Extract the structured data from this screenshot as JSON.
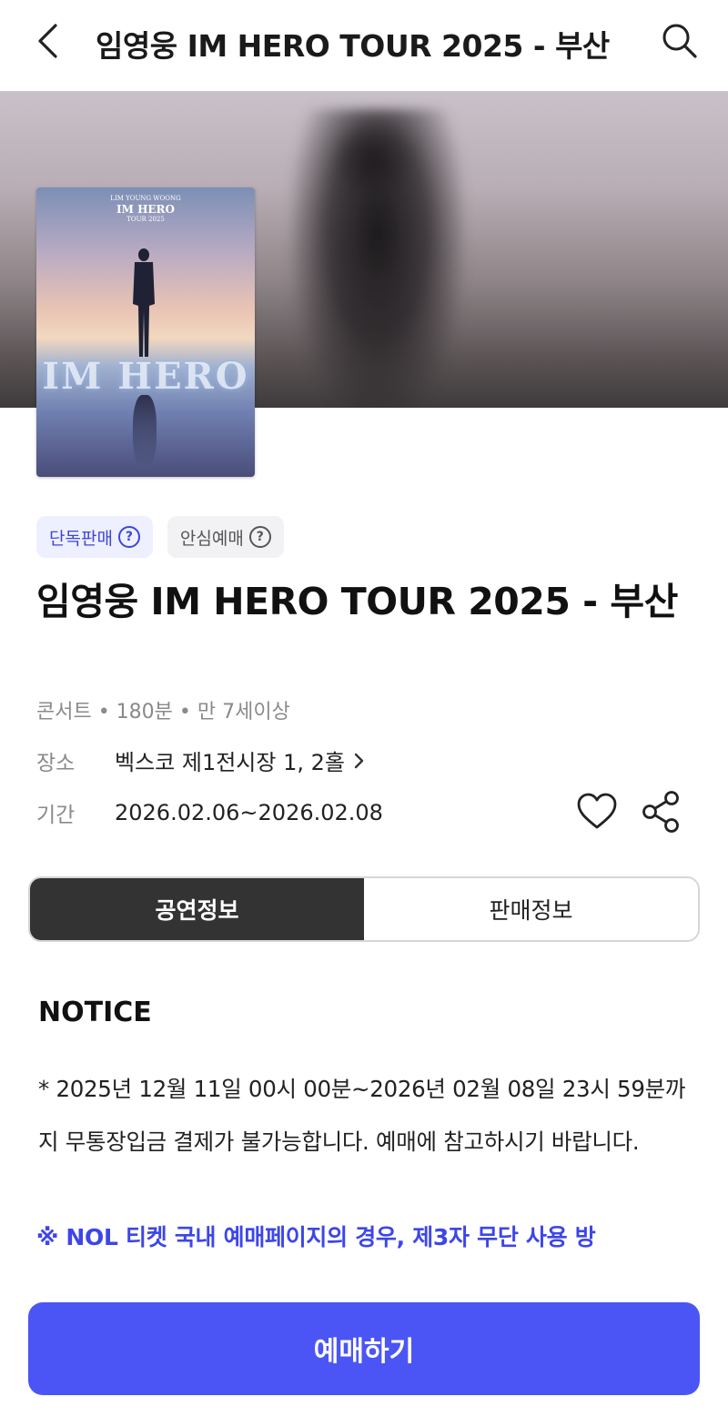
{
  "header": {
    "title": "임영웅 IM HERO TOUR 2025 - 부산",
    "back_icon": "chevron-left-icon",
    "search_icon": "search-icon"
  },
  "poster": {
    "top_text": "LIM YOUNG WOONG",
    "main_text": "IM HERO",
    "sub_text": "TOUR 2025",
    "logo_text": "IM HERO"
  },
  "badges": [
    {
      "label": "단독판매",
      "icon": "question-circle-icon",
      "color": "#3d46d6"
    },
    {
      "label": "안심예매",
      "icon": "question-circle-icon",
      "color": "#555555"
    }
  ],
  "event": {
    "title": "임영웅 IM HERO TOUR 2025 - 부산",
    "meta": "콘서트 • 180분 • 만 7세이상",
    "venue_label": "장소",
    "venue_value": "벡스코 제1전시장 1, 2홀",
    "period_label": "기간",
    "period_value": "2026.02.06~2026.02.08"
  },
  "actions": {
    "like_icon": "heart-icon",
    "share_icon": "share-icon"
  },
  "tabs": [
    {
      "label": "공연정보",
      "active": true
    },
    {
      "label": "판매정보",
      "active": false
    }
  ],
  "notice": {
    "heading": "NOTICE",
    "body": "* 2025년 12월 11일 00시 00분~2026년 02월 08일 23시 59분까지 무통장입금 결제가 불가능합니다. 예매에 참고하시기 바랍니다.",
    "highlight": "※ NOL 티켓 국내 예매페이지의 경우, 제3자 무단 사용 방"
  },
  "cta": {
    "label": "예매하기",
    "color": "#4b55f5"
  }
}
